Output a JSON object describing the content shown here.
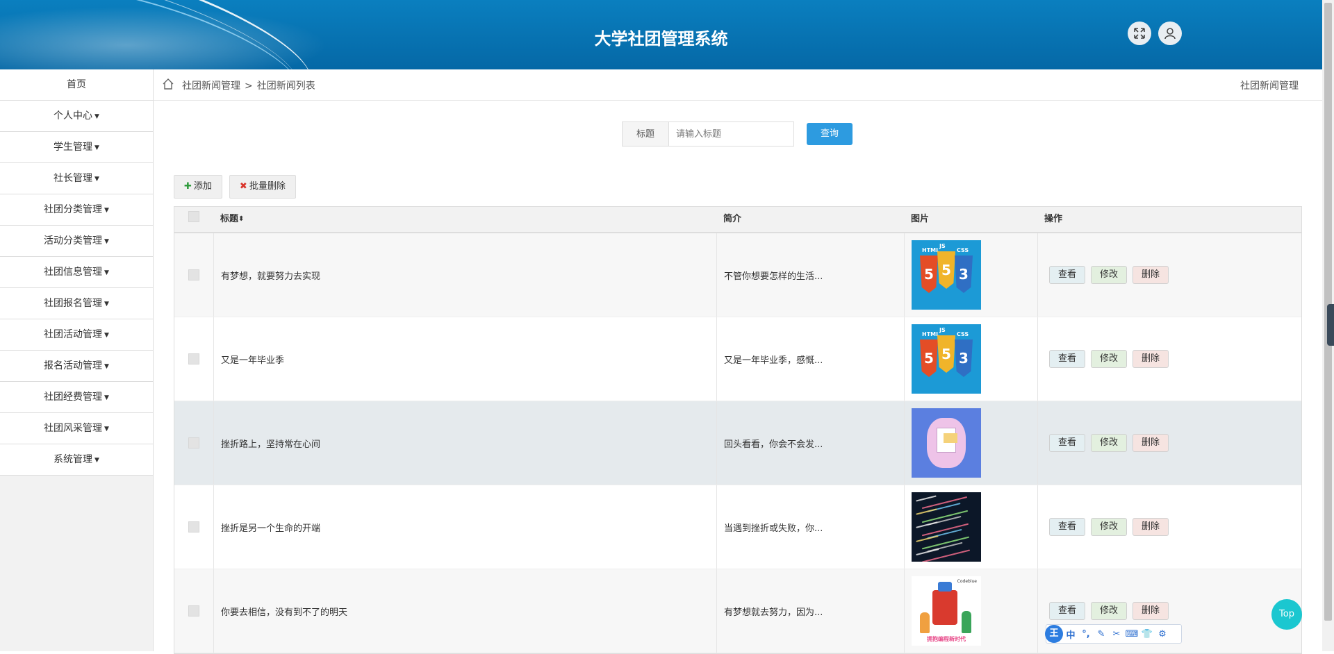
{
  "header": {
    "title": "大学社团管理系统",
    "fullscreen_icon": "expand-icon",
    "user_icon": "user-icon"
  },
  "sidebar": {
    "items": [
      {
        "label": "首页",
        "dropdown": false
      },
      {
        "label": "个人中心",
        "dropdown": true
      },
      {
        "label": "学生管理",
        "dropdown": true
      },
      {
        "label": "社长管理",
        "dropdown": true
      },
      {
        "label": "社团分类管理",
        "dropdown": true
      },
      {
        "label": "活动分类管理",
        "dropdown": true
      },
      {
        "label": "社团信息管理",
        "dropdown": true
      },
      {
        "label": "社团报名管理",
        "dropdown": true
      },
      {
        "label": "社团活动管理",
        "dropdown": true
      },
      {
        "label": "报名活动管理",
        "dropdown": true
      },
      {
        "label": "社团经费管理",
        "dropdown": true
      },
      {
        "label": "社团风采管理",
        "dropdown": true
      },
      {
        "label": "系统管理",
        "dropdown": true
      }
    ]
  },
  "breadcrumb": {
    "home_icon": "home-icon",
    "level1": "社团新闻管理",
    "separator": ">",
    "level2": "社团新闻列表",
    "right_title": "社团新闻管理"
  },
  "search": {
    "label": "标题",
    "placeholder": "请输入标题",
    "value": "",
    "button": "查询"
  },
  "toolbar": {
    "add_label": "添加",
    "batch_delete_label": "批量删除"
  },
  "table": {
    "columns": {
      "title": "标题",
      "sort_icon": "⬍",
      "desc": "简介",
      "image": "图片",
      "ops": "操作"
    },
    "rows": [
      {
        "title": "有梦想，就要努力去实现",
        "desc": "不管你想要怎样的生活...",
        "image": "html5-css3-js-logos"
      },
      {
        "title": "又是一年毕业季",
        "desc": "又是一年毕业季，感慨...",
        "image": "html5-css3-js-logos"
      },
      {
        "title": "挫折路上，坚持常在心间",
        "desc": "回头看看，你会不会发...",
        "image": "purple-document-illustration"
      },
      {
        "title": "挫折是另一个生命的开端",
        "desc": "当遇到挫折或失败，你...",
        "image": "code-screen"
      },
      {
        "title": "你要去相信，没有到不了的明天",
        "desc": "有梦想就去努力，因为...",
        "image": "robot-kids-illustration"
      }
    ],
    "ops": {
      "view": "查看",
      "edit": "修改",
      "delete": "删除"
    }
  },
  "thumb_text": {
    "html": "HTML",
    "js": "JS",
    "css": "CSS",
    "five": "5",
    "three": "3",
    "robot_brand": "Codeblue",
    "robot_caption": "拥抱编程新时代"
  },
  "top_button": "Top",
  "ime": {
    "logo": "王",
    "items": [
      "中",
      "°,",
      "✎",
      "✂",
      "⌨",
      "👕",
      "⚙"
    ]
  }
}
